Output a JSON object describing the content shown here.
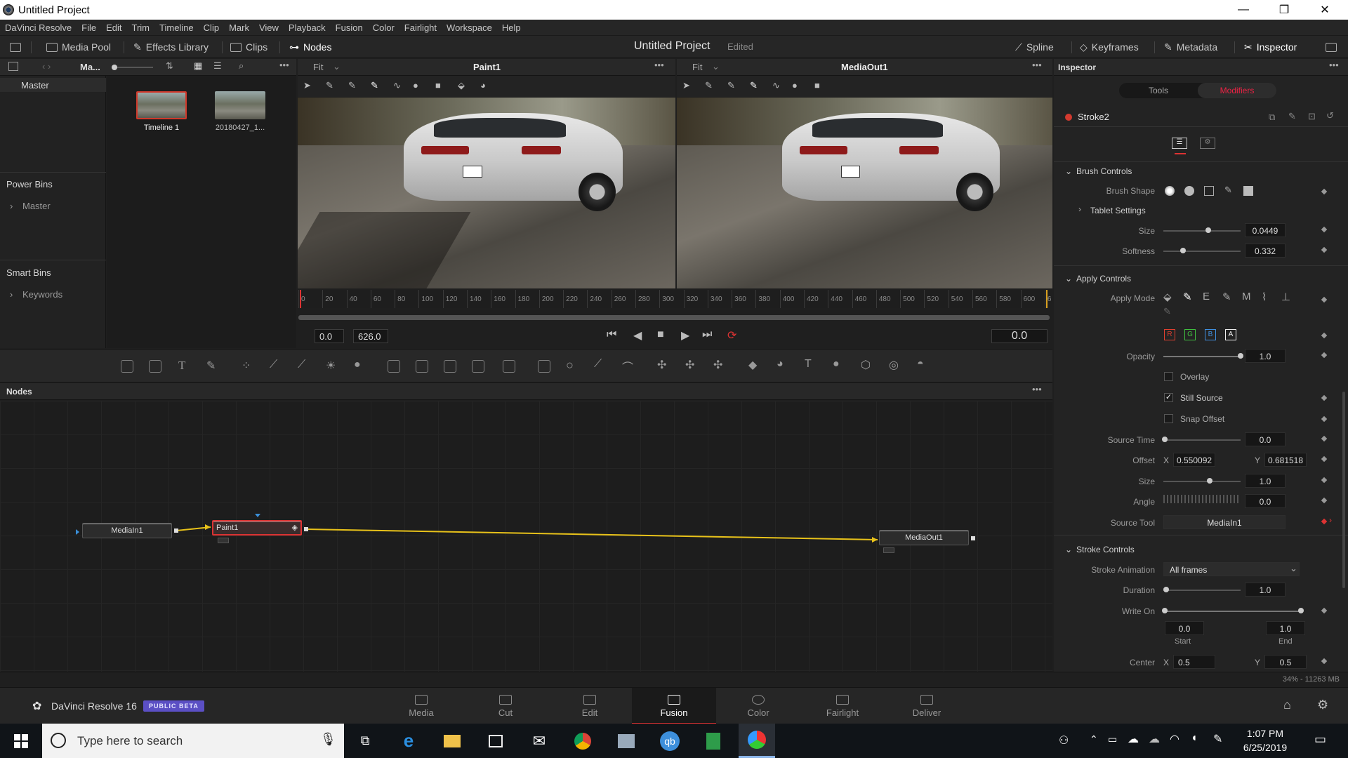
{
  "window": {
    "title": "Untitled Project",
    "minimize": "—",
    "maximize": "❐",
    "close": "✕"
  },
  "menu": [
    "DaVinci Resolve",
    "File",
    "Edit",
    "Trim",
    "Timeline",
    "Clip",
    "Mark",
    "View",
    "Playback",
    "Fusion",
    "Color",
    "Fairlight",
    "Workspace",
    "Help"
  ],
  "toolbar": {
    "media_pool": "Media Pool",
    "effects_library": "Effects Library",
    "clips": "Clips",
    "nodes": "Nodes",
    "project_title": "Untitled Project",
    "edited": "Edited",
    "spline": "Spline",
    "keyframes": "Keyframes",
    "metadata": "Metadata",
    "inspector": "Inspector"
  },
  "media_pool": {
    "bin_name": "Ma...",
    "bins": {
      "master": "Master",
      "power_bins": "Power Bins",
      "power_master": "Master",
      "smart_bins": "Smart Bins",
      "keywords": "Keywords"
    },
    "clips": [
      {
        "name": "Timeline 1"
      },
      {
        "name": "20180427_1..."
      }
    ]
  },
  "viewer_left": {
    "fit": "Fit",
    "name": "Paint1"
  },
  "viewer_right": {
    "fit": "Fit",
    "name": "MediaOut1"
  },
  "ruler_ticks": [
    "0",
    "20",
    "40",
    "60",
    "80",
    "100",
    "120",
    "140",
    "160",
    "180",
    "200",
    "220",
    "240",
    "260",
    "280",
    "300",
    "320",
    "340",
    "360",
    "380",
    "400",
    "420",
    "440",
    "460",
    "480",
    "500",
    "520",
    "540",
    "560",
    "580",
    "600",
    "6"
  ],
  "transport": {
    "start": "0.0",
    "end": "626.0",
    "current": "0.0"
  },
  "nodes_panel": {
    "title": "Nodes",
    "nodes": {
      "media_in": "MediaIn1",
      "paint": "Paint1",
      "media_out": "MediaOut1"
    }
  },
  "inspector": {
    "title": "Inspector",
    "tab_tools": "Tools",
    "tab_modifiers": "Modifiers",
    "tool_name": "Stroke2",
    "brush_controls": "Brush Controls",
    "brush_shape": "Brush Shape",
    "tablet_settings": "Tablet Settings",
    "size_label": "Size",
    "size_value": "0.0449",
    "softness_label": "Softness",
    "softness_value": "0.332",
    "apply_controls": "Apply Controls",
    "apply_mode": "Apply Mode",
    "channels": {
      "r": "R",
      "g": "G",
      "b": "B",
      "a": "A"
    },
    "opacity_label": "Opacity",
    "opacity_value": "1.0",
    "overlay": "Overlay",
    "still_source": "Still Source",
    "snap_offset": "Snap Offset",
    "source_time_label": "Source Time",
    "source_time_value": "0.0",
    "offset_label": "Offset",
    "offset_x_label": "X",
    "offset_x": "0.550092",
    "offset_y_label": "Y",
    "offset_y": "0.681518",
    "size2_label": "Size",
    "size2_value": "1.0",
    "angle_label": "Angle",
    "angle_value": "0.0",
    "source_tool_label": "Source Tool",
    "source_tool_value": "MediaIn1",
    "stroke_controls": "Stroke Controls",
    "stroke_animation_label": "Stroke Animation",
    "stroke_animation_value": "All frames",
    "duration_label": "Duration",
    "duration_value": "1.0",
    "write_on_label": "Write On",
    "write_on_start": "0.0",
    "write_on_end": "1.0",
    "start_label": "Start",
    "end_label": "End",
    "center_label": "Center",
    "center_x_label": "X",
    "center_x": "0.5",
    "center_y_label": "Y",
    "center_y": "0.5"
  },
  "status": {
    "memory": "34% - 11263 MB"
  },
  "app_brand": {
    "name": "DaVinci Resolve 16",
    "badge": "PUBLIC BETA"
  },
  "pages": [
    "Media",
    "Cut",
    "Edit",
    "Fusion",
    "Color",
    "Fairlight",
    "Deliver"
  ],
  "taskbar": {
    "search_placeholder": "Type here to search",
    "time": "1:07 PM",
    "date": "6/25/2019"
  },
  "colors": {
    "accent_red": "#d33a2f",
    "node_link": "#e8c21a",
    "badge": "#5b4fc4"
  }
}
